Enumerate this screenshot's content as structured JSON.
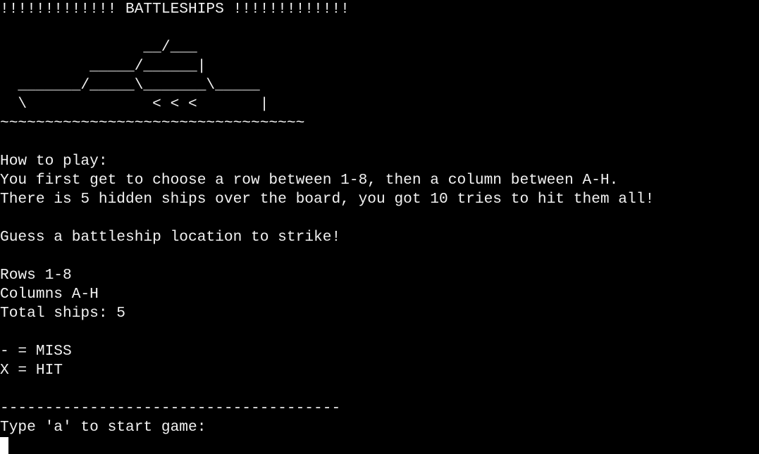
{
  "terminal": {
    "title": "!!!!!!!!!!!!! BATTLESHIPS !!!!!!!!!!!!!",
    "ship_art": [
      "                __/___",
      "          _____/______|",
      "  _______/_____\\_______\\_____",
      "  \\              < < <       |",
      "~~~~~~~~~~~~~~~~~~~~~~~~~~~~~~~~~~"
    ],
    "how_to_play_heading": "How to play:",
    "instructions_1": "You first get to choose a row between 1-8, then a column between A-H.",
    "instructions_2": "There is 5 hidden ships over the board, you got 10 tries to hit them all!",
    "prompt_guess": "Guess a battleship location to strike!",
    "rows_info": "Rows 1-8",
    "columns_info": "Columns A-H",
    "total_ships": "Total ships: 5",
    "legend_miss": "- = MISS",
    "legend_hit": "X = HIT",
    "separator": "--------------------------------------",
    "start_prompt": "Type 'a' to start game:",
    "input_value": ""
  }
}
